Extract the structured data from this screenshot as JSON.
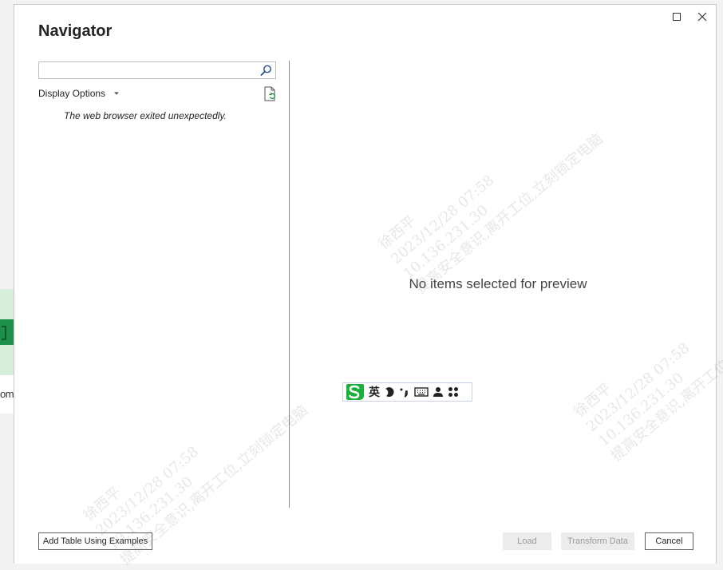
{
  "window": {
    "title": "Navigator"
  },
  "search": {
    "value": "",
    "placeholder": ""
  },
  "left_pane": {
    "display_options_label": "Display Options",
    "error_message": "The web browser exited unexpectedly."
  },
  "preview": {
    "empty_message": "No items selected for preview"
  },
  "footer": {
    "add_table_label": "Add Table Using Examples",
    "load_label": "Load",
    "transform_label": "Transform Data",
    "cancel_label": "Cancel"
  },
  "ime": {
    "mode_label": "英"
  },
  "background_app": {
    "partial_text": "om"
  },
  "watermark": {
    "name": "徐西平",
    "datetime": "2023/12/28 07:58",
    "ip": "10.136.231.30",
    "notice": "提高安全意识,离开工位,立刻锁定电脑"
  },
  "colors": {
    "window_bg": "#ffffff",
    "border": "#c8c8c8",
    "text": "#252423",
    "disabled_button_bg": "#ececec",
    "ime_green": "#1aae3a"
  }
}
